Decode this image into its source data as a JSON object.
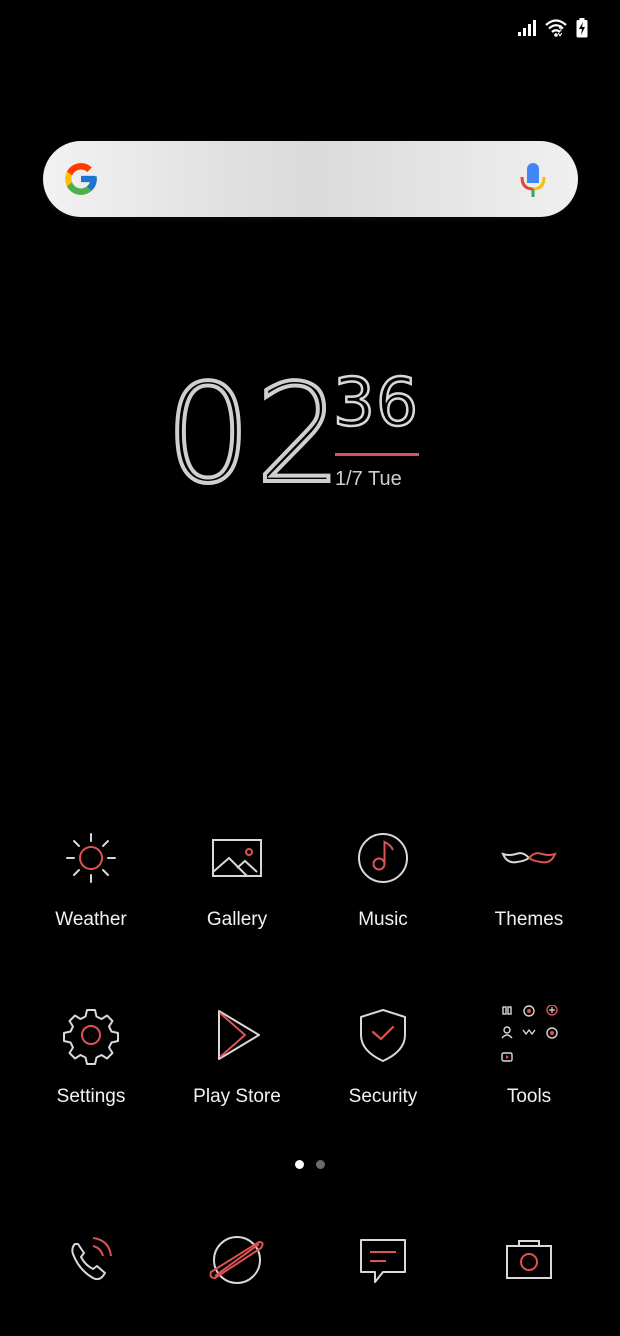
{
  "colors": {
    "background": "#000000",
    "accent": "#e05252",
    "icon_stroke": "#d8d8d8",
    "label": "#f2f2f2",
    "dot_active": "#ffffff",
    "dot_inactive": "#6a6a6a"
  },
  "status_bar": {
    "icons": [
      "signal-icon",
      "wifi-icon",
      "battery-charging-icon"
    ]
  },
  "search": {
    "logo": "google-logo-icon",
    "mic": "mic-icon"
  },
  "clock": {
    "hours": "02",
    "minutes": "36",
    "date": "1/7 Tue"
  },
  "apps": [
    {
      "label": "Weather",
      "icon": "sun-icon"
    },
    {
      "label": "Gallery",
      "icon": "image-icon"
    },
    {
      "label": "Music",
      "icon": "music-note-icon"
    },
    {
      "label": "Themes",
      "icon": "mustache-icon"
    },
    {
      "label": "Settings",
      "icon": "gear-icon"
    },
    {
      "label": "Play Store",
      "icon": "play-store-icon"
    },
    {
      "label": "Security",
      "icon": "shield-check-icon"
    },
    {
      "label": "Tools",
      "icon": "tools-folder-icon"
    }
  ],
  "page_indicator": {
    "total": 2,
    "current": 1
  },
  "dock": [
    {
      "icon": "phone-icon"
    },
    {
      "icon": "browser-planet-icon"
    },
    {
      "icon": "message-icon"
    },
    {
      "icon": "camera-icon"
    }
  ]
}
